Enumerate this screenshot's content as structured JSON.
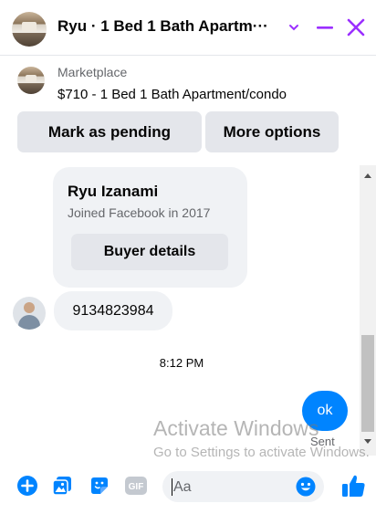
{
  "header": {
    "title": "Ryu · 1 Bed 1 Bath Apartm···",
    "icons": [
      "chevron-down-icon",
      "minimize-icon",
      "close-icon"
    ],
    "accent_color": "#9b2fff"
  },
  "listing": {
    "label": "Marketplace",
    "description": "$710 - 1 Bed 1 Bath Apartment/condo",
    "mark_pending_label": "Mark as pending",
    "more_options_label": "More options"
  },
  "conversation": {
    "buyer_name": "Ryu Izanami",
    "buyer_joined": "Joined Facebook in 2017",
    "buyer_details_label": "Buyer details",
    "phone_message": "9134823984",
    "timestamp": "8:12 PM",
    "sent_message": "ok",
    "sent_status": "Sent"
  },
  "watermark": {
    "title": "Activate Windows",
    "subtitle": "Go to Settings to activate Windows."
  },
  "composer": {
    "placeholder": "Aa",
    "icons": [
      "plus-icon",
      "photo-icon",
      "sticker-icon",
      "gif-icon",
      "emoji-icon",
      "thumbs-up-icon"
    ],
    "gif_label": "GIF",
    "brand_color": "#0084ff"
  }
}
